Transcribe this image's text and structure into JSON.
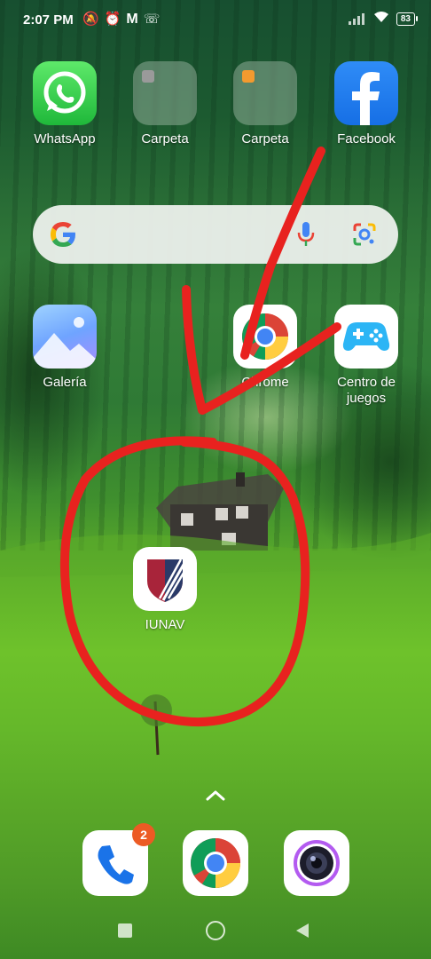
{
  "status_bar": {
    "time": "2:07 PM",
    "battery": "83",
    "left_icons": [
      "mute-alarm-icon",
      "alarm-icon",
      "gmail-icon",
      "call-icon"
    ],
    "right_icons": [
      "signal-icon",
      "wifi-icon",
      "battery-icon"
    ]
  },
  "home": {
    "row1": [
      {
        "label": "WhatsApp",
        "icon": "whatsapp-icon"
      },
      {
        "label": "Carpeta",
        "icon": "folder-icon"
      },
      {
        "label": "Carpeta",
        "icon": "folder-icon"
      },
      {
        "label": "Facebook",
        "icon": "facebook-icon"
      }
    ],
    "search_widget": {
      "icons": [
        "google-g-icon",
        "microphone-icon",
        "google-lens-icon"
      ]
    },
    "row2": [
      {
        "label": "Galería",
        "icon": "gallery-icon"
      },
      {
        "label": "Chrome",
        "icon": "chrome-icon"
      },
      {
        "label": "Centro de juegos",
        "icon": "game-controller-icon"
      }
    ],
    "highlighted_app": {
      "label": "IUNAV",
      "icon": "iunav-shield-icon"
    }
  },
  "annotations": {
    "arrow_color": "#e8221f",
    "circle_color": "#e8221f"
  },
  "dock": {
    "apps": [
      "phone-icon",
      "chrome-icon",
      "camera-icon"
    ],
    "phone_badge": "2"
  },
  "colors": {
    "accent": "#ec5b24",
    "whatsapp": "#25d366",
    "facebook": "#1877f2"
  }
}
